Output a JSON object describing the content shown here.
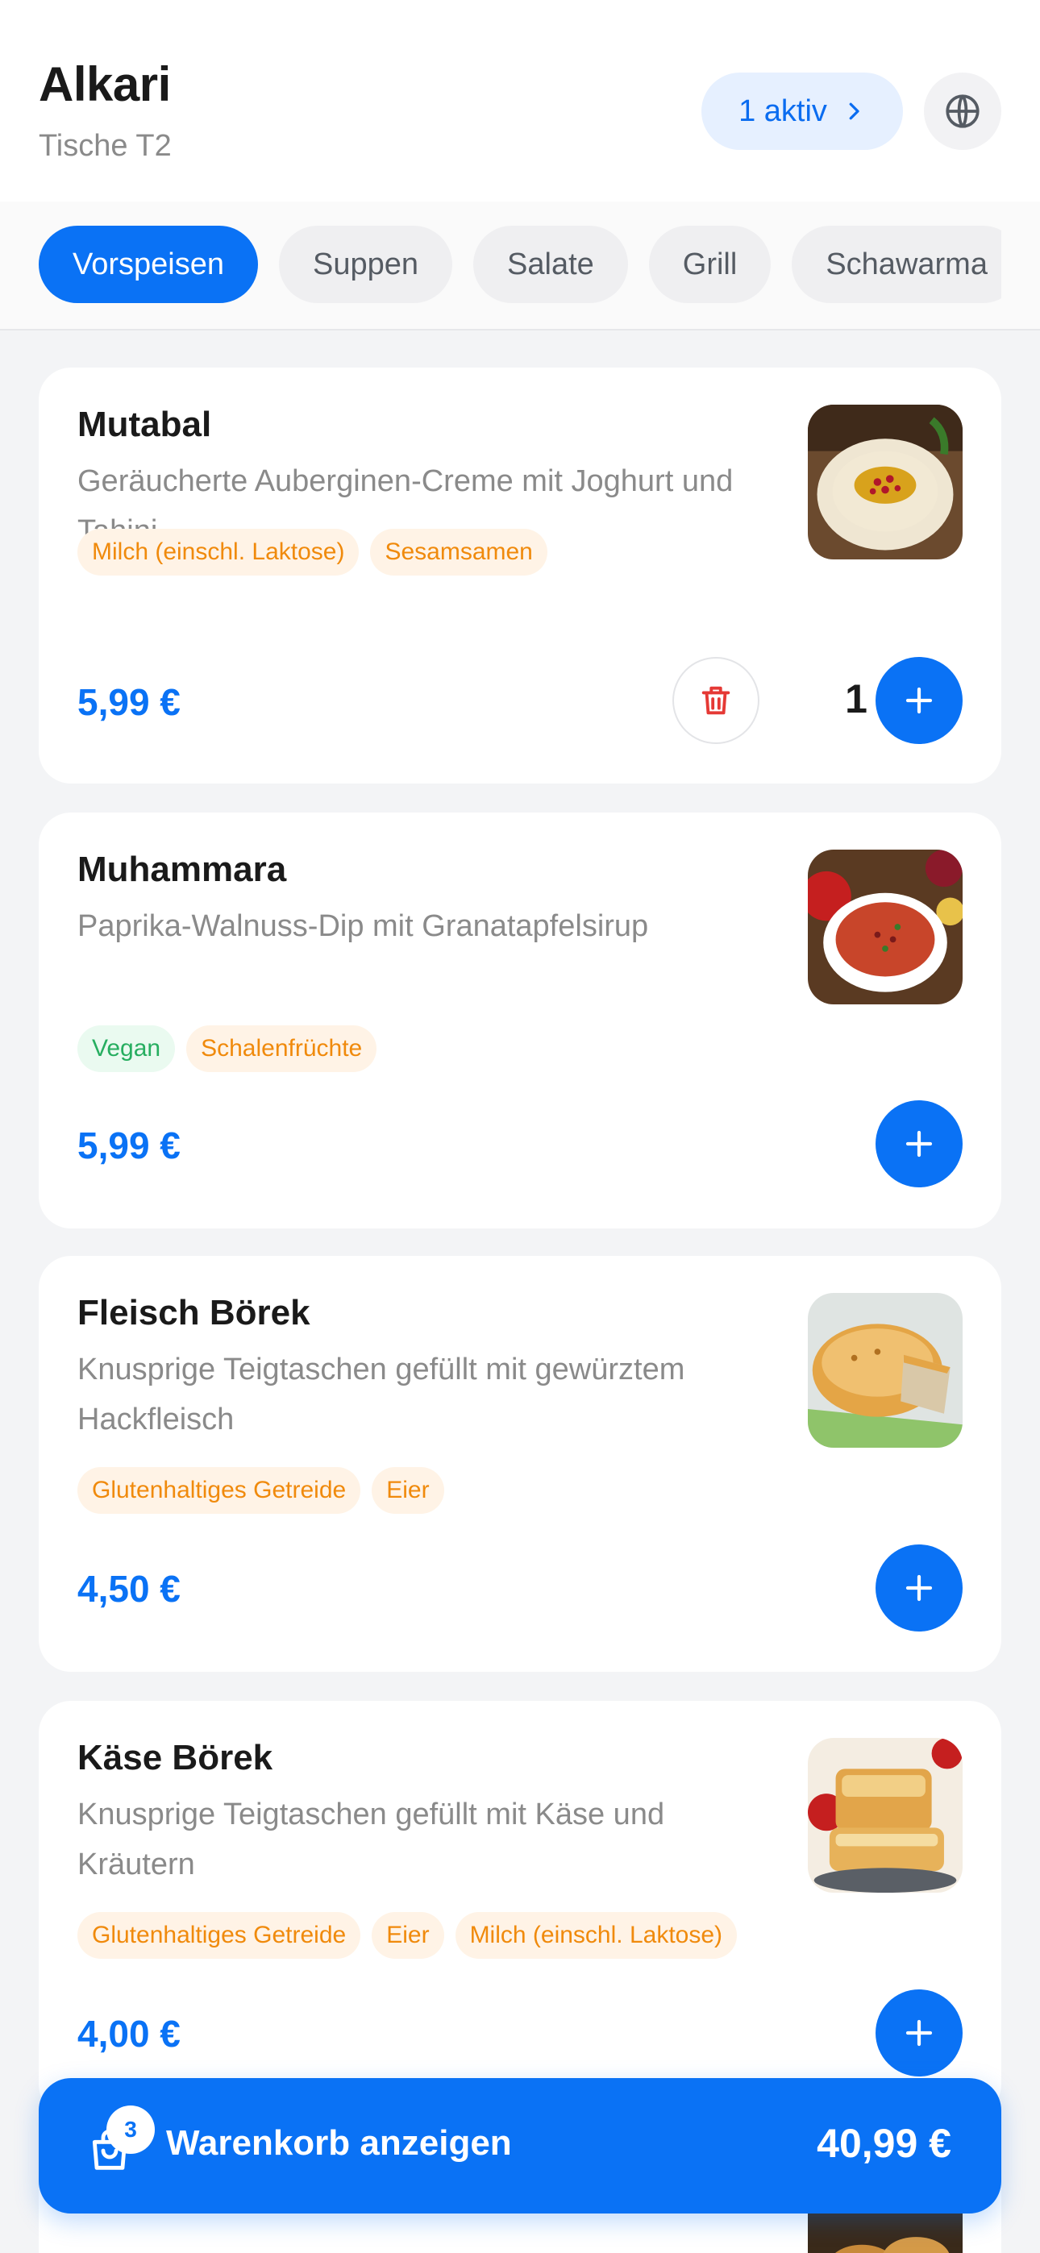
{
  "header": {
    "restaurant_name": "Alkari",
    "table_label": "Tische T2",
    "active_orders_label": "1 aktiv"
  },
  "categories": [
    {
      "label": "Vorspeisen",
      "active": true
    },
    {
      "label": "Suppen",
      "active": false
    },
    {
      "label": "Salate",
      "active": false
    },
    {
      "label": "Grill",
      "active": false
    },
    {
      "label": "Schawarma",
      "active": false
    }
  ],
  "items": [
    {
      "name": "Mutabal",
      "description": "Geräucherte Auberginen-Creme mit Joghurt und Tahini",
      "tags": [
        {
          "label": "Milch (einschl. Laktose)",
          "color": "orange"
        },
        {
          "label": "Sesamsamen",
          "color": "orange"
        }
      ],
      "price": "5,99 €",
      "quantity": "1",
      "image": "mutabal-dish"
    },
    {
      "name": "Muhammara",
      "description": "Paprika-Walnuss-Dip mit Granatapfelsirup",
      "tags": [
        {
          "label": "Vegan",
          "color": "green"
        },
        {
          "label": "Schalenfrüchte",
          "color": "orange"
        }
      ],
      "price": "5,99 €",
      "image": "muhammara-dish"
    },
    {
      "name": "Fleisch Börek",
      "description": "Knusprige Teigtaschen gefüllt mit gewürztem Hackfleisch",
      "tags": [
        {
          "label": "Glutenhaltiges Getreide",
          "color": "orange"
        },
        {
          "label": "Eier",
          "color": "orange"
        }
      ],
      "price": "4,50 €",
      "image": "fleisch-borek-dish"
    },
    {
      "name": "Käse Börek",
      "description": "Knusprige Teigtaschen gefüllt mit Käse und Kräutern",
      "tags": [
        {
          "label": "Glutenhaltiges Getreide",
          "color": "orange"
        },
        {
          "label": "Eier",
          "color": "orange"
        },
        {
          "label": "Milch (einschl. Laktose)",
          "color": "orange"
        }
      ],
      "price": "4,00 €",
      "image": "kase-borek-dish"
    }
  ],
  "cart": {
    "count": "3",
    "label": "Warenkorb anzeigen",
    "total": "40,99 €"
  },
  "colors": {
    "accent": "#0a72f5",
    "tag_orange": "#f08a0c",
    "tag_green": "#27ae60",
    "delete_red": "#e53935"
  }
}
